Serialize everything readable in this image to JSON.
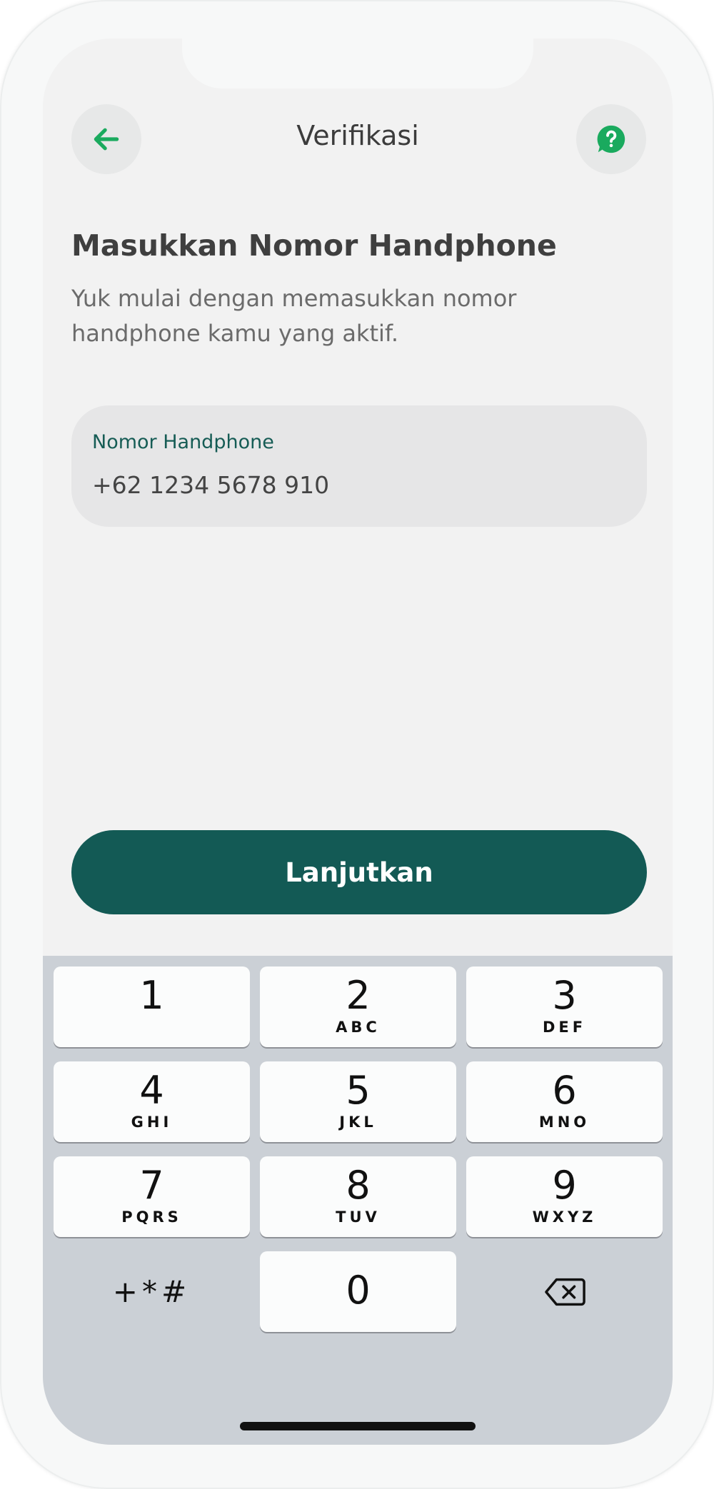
{
  "header": {
    "title": "Verifikasi",
    "back_icon": "arrow-left-icon",
    "help_icon": "help-bubble-icon"
  },
  "content": {
    "heading": "Masukkan Nomor Handphone",
    "subtitle": "Yuk mulai dengan memasukkan nomor handphone kamu yang aktif."
  },
  "phone_field": {
    "label": "Nomor Handphone",
    "value": "+62 1234 5678 910"
  },
  "cta": {
    "label": "Lanjutkan"
  },
  "keypad": {
    "keys": [
      {
        "num": "1",
        "letters": ""
      },
      {
        "num": "2",
        "letters": "ABC"
      },
      {
        "num": "3",
        "letters": "DEF"
      },
      {
        "num": "4",
        "letters": "GHI"
      },
      {
        "num": "5",
        "letters": "JKL"
      },
      {
        "num": "6",
        "letters": "MNO"
      },
      {
        "num": "7",
        "letters": "PQRS"
      },
      {
        "num": "8",
        "letters": "TUV"
      },
      {
        "num": "9",
        "letters": "WXYZ"
      }
    ],
    "symbols": "+*#",
    "zero": "0",
    "delete_icon": "backspace-icon"
  },
  "colors": {
    "brand": "#135a55",
    "accent": "#1aaa5e",
    "field_label": "#165c55",
    "keyboard_bg": "#cbd0d6"
  }
}
